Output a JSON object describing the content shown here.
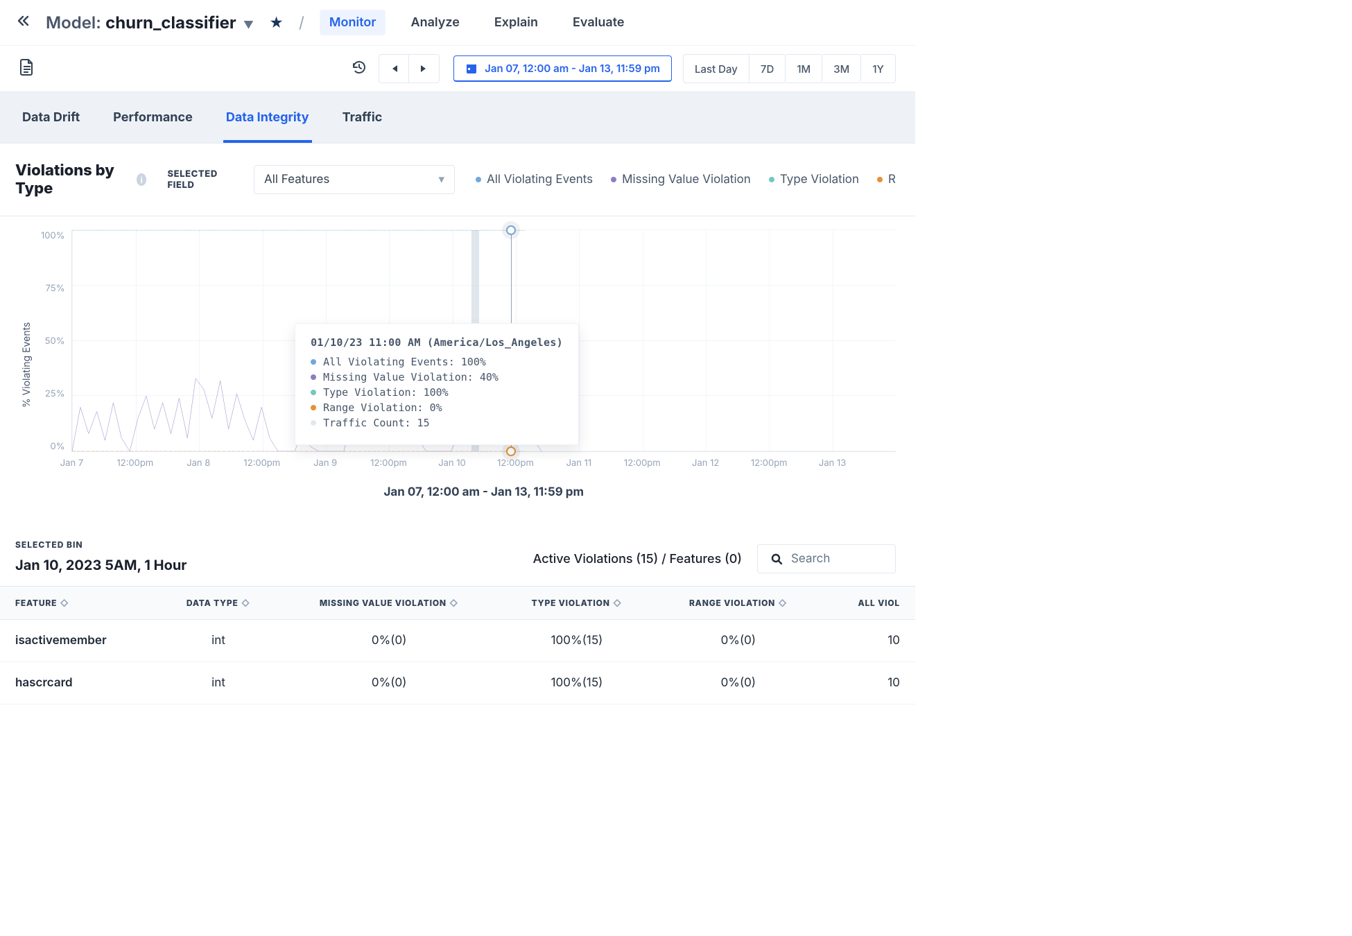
{
  "header": {
    "model_prefix": "Model:",
    "model_name": "churn_classifier",
    "tabs": [
      "Monitor",
      "Analyze",
      "Explain",
      "Evaluate"
    ],
    "active_tab_index": 0
  },
  "toolbar": {
    "date_range": "Jan 07, 12:00 am - Jan 13, 11:59 pm",
    "range_buttons": [
      "Last Day",
      "7D",
      "1M",
      "3M",
      "1Y"
    ]
  },
  "subtabs": {
    "items": [
      "Data Drift",
      "Performance",
      "Data Integrity",
      "Traffic"
    ],
    "active_index": 2
  },
  "violations": {
    "title": "Violations by Type",
    "selected_field_label": "SELECTED FIELD",
    "selected_field_value": "All Features",
    "legend": [
      {
        "label": "All Violating Events",
        "color": "#6fa8dc"
      },
      {
        "label": "Missing Value Violation",
        "color": "#8e7cc3"
      },
      {
        "label": "Type Violation",
        "color": "#76c7c0"
      },
      {
        "label": "R",
        "color": "#e69138"
      }
    ]
  },
  "chart_data": {
    "type": "line",
    "ylabel": "% Violating Events",
    "x_title": "Jan 07, 12:00 am - Jan 13, 11:59 pm",
    "ylim": [
      0,
      100
    ],
    "y_ticks": [
      "100%",
      "75%",
      "50%",
      "25%",
      "0%"
    ],
    "x_ticks": [
      {
        "label": "Jan 7",
        "pos": 0
      },
      {
        "label": "12:00pm",
        "pos": 7.69
      },
      {
        "label": "Jan 8",
        "pos": 15.38
      },
      {
        "label": "12:00pm",
        "pos": 23.08
      },
      {
        "label": "Jan 9",
        "pos": 30.77
      },
      {
        "label": "12:00pm",
        "pos": 38.46
      },
      {
        "label": "Jan 10",
        "pos": 46.15
      },
      {
        "label": "12:00pm",
        "pos": 53.85
      },
      {
        "label": "Jan 11",
        "pos": 61.54
      },
      {
        "label": "12:00pm",
        "pos": 69.23
      },
      {
        "label": "Jan 12",
        "pos": 76.92
      },
      {
        "label": "12:00pm",
        "pos": 84.62
      },
      {
        "label": "Jan 13",
        "pos": 92.31
      }
    ],
    "highlight_x_pct": 53.3,
    "selection_band": {
      "left_pct": 48.5,
      "width_pct": 0.85
    },
    "series": [
      {
        "name": "All Violating Events",
        "color": "#6fa8dc",
        "stroke_width": 1.4,
        "x_max_pct": 55.0,
        "points": [
          [
            0,
            100
          ],
          [
            55,
            100
          ]
        ]
      },
      {
        "name": "Type Violation",
        "color": "#76c7c0",
        "stroke_width": 1.4,
        "dash": "4 3",
        "x_max_pct": 55.0,
        "points": [
          [
            0,
            100
          ],
          [
            55,
            100
          ]
        ]
      },
      {
        "name": "Range Violation",
        "color": "#e69138",
        "stroke_width": 1.4,
        "dash": "4 3",
        "x_max_pct": 55.0,
        "points": [
          [
            0,
            0
          ],
          [
            55,
            0
          ]
        ]
      },
      {
        "name": "Missing Value Violation",
        "color": "#8e7cc3",
        "stroke_width": 1.4,
        "x_max_pct": 55.0,
        "points": [
          [
            0,
            0
          ],
          [
            1,
            20
          ],
          [
            2,
            8
          ],
          [
            3,
            18
          ],
          [
            4,
            5
          ],
          [
            5,
            22
          ],
          [
            6,
            6
          ],
          [
            7,
            0
          ],
          [
            8,
            15
          ],
          [
            9,
            25
          ],
          [
            10,
            10
          ],
          [
            11,
            22
          ],
          [
            12,
            8
          ],
          [
            13,
            24
          ],
          [
            14,
            6
          ],
          [
            15,
            33
          ],
          [
            16,
            28
          ],
          [
            17,
            15
          ],
          [
            18,
            32
          ],
          [
            19,
            10
          ],
          [
            20,
            26
          ],
          [
            21,
            14
          ],
          [
            22,
            5
          ],
          [
            23,
            20
          ],
          [
            24,
            6
          ],
          [
            25,
            0
          ],
          [
            26,
            0
          ],
          [
            27,
            0
          ],
          [
            28,
            8
          ],
          [
            29,
            2
          ],
          [
            30,
            0
          ],
          [
            31,
            0
          ],
          [
            32,
            0
          ],
          [
            33,
            0
          ],
          [
            34,
            15
          ],
          [
            35,
            6
          ],
          [
            36,
            12
          ],
          [
            37,
            14
          ],
          [
            38,
            5
          ],
          [
            39,
            20
          ],
          [
            40,
            8
          ],
          [
            41,
            18
          ],
          [
            42,
            6
          ],
          [
            43,
            0
          ],
          [
            44,
            0
          ],
          [
            45,
            0
          ],
          [
            46,
            0
          ],
          [
            47,
            8
          ],
          [
            48,
            30
          ],
          [
            49,
            10
          ],
          [
            50,
            22
          ],
          [
            51,
            8
          ],
          [
            52,
            5
          ],
          [
            53,
            40
          ],
          [
            54,
            10
          ],
          [
            55,
            26
          ],
          [
            56,
            6
          ],
          [
            57,
            0
          ]
        ]
      }
    ],
    "markers": [
      {
        "x_pct": 53.3,
        "y_val": 100,
        "color": "#6fa8dc"
      },
      {
        "x_pct": 53.3,
        "y_val": 40,
        "color": "#8e7cc3"
      },
      {
        "x_pct": 53.3,
        "y_val": 0,
        "color": "#e69138"
      }
    ],
    "tooltip": {
      "pos_pct": {
        "left": 27,
        "top": 42
      },
      "title": "01/10/23 11:00 AM (America/Los_Angeles)",
      "rows": [
        {
          "color": "#6fa8dc",
          "text": "All Violating Events: 100%"
        },
        {
          "color": "#8e7cc3",
          "text": "Missing Value Violation: 40%"
        },
        {
          "color": "#76c7c0",
          "text": "Type Violation: 100%"
        },
        {
          "color": "#e69138",
          "text": "Range Violation: 0%"
        },
        {
          "color": "#e2e8f0",
          "text": "Traffic Count: 15"
        }
      ]
    }
  },
  "bin": {
    "label": "SELECTED BIN",
    "value": "Jan 10, 2023 5AM, 1 Hour",
    "summary": "Active Violations (15) / Features (0)",
    "search_placeholder": "Search"
  },
  "table": {
    "columns": [
      "FEATURE",
      "DATA TYPE",
      "MISSING VALUE VIOLATION",
      "TYPE VIOLATION",
      "RANGE VIOLATION",
      "ALL VIOL"
    ],
    "rows": [
      {
        "feature": "isactivemember",
        "dtype": "int",
        "missing": "0%(0)",
        "type": "100%(15)",
        "range": "0%(0)",
        "all": "10"
      },
      {
        "feature": "hascrcard",
        "dtype": "int",
        "missing": "0%(0)",
        "type": "100%(15)",
        "range": "0%(0)",
        "all": "10"
      }
    ]
  }
}
